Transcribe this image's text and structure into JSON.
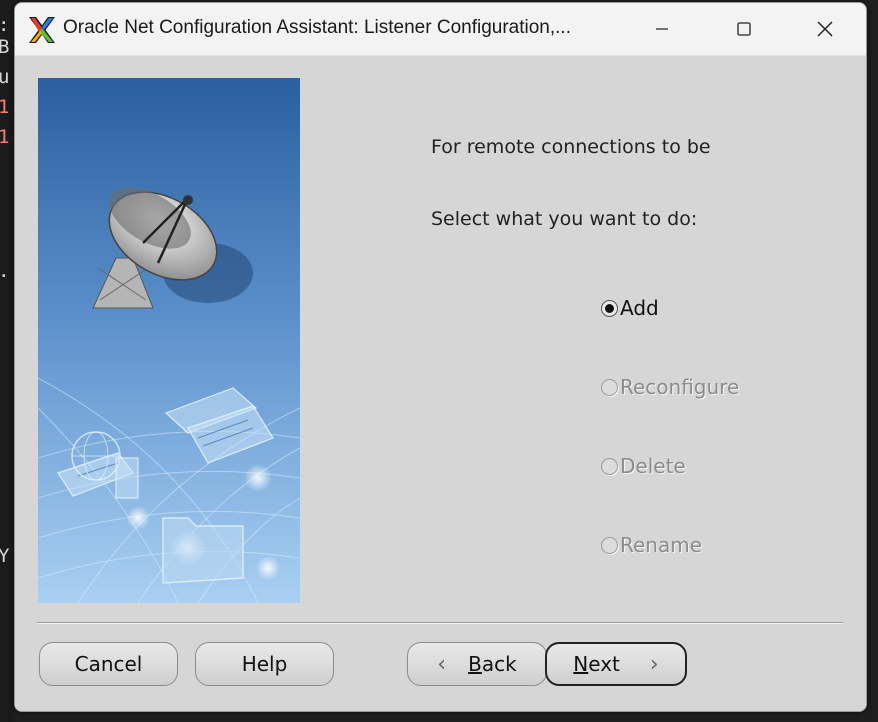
{
  "background": {
    "chars": [
      {
        "text": ":",
        "color": "#d6d6d6"
      },
      {
        "text": "B",
        "color": "#d6d6d6"
      },
      {
        "text": "u",
        "color": "#d6d6d6"
      },
      {
        "text": "1",
        "color": "#ff7b72"
      },
      {
        "text": "1",
        "color": "#ff7b72"
      },
      {
        "text": ".",
        "color": "#d6d6d6"
      },
      {
        "text": "Y",
        "color": "#d6d6d6"
      }
    ]
  },
  "window": {
    "title": "Oracle Net Configuration Assistant: Listener Configuration,...",
    "controls": {
      "minimize": "minimize-icon",
      "maximize": "maximize-icon",
      "close": "close-icon"
    },
    "app_icon": "x-logo-icon"
  },
  "side_image": {
    "description_icon": "satellite-dish-network-illustration"
  },
  "main": {
    "line1": "For remote connections to be",
    "line2": "Select what you want to do:",
    "options": [
      {
        "label": "Add",
        "selected": true,
        "enabled": true
      },
      {
        "label": "Reconfigure",
        "selected": false,
        "enabled": false
      },
      {
        "label": "Delete",
        "selected": false,
        "enabled": false
      },
      {
        "label": "Rename",
        "selected": false,
        "enabled": false
      }
    ]
  },
  "buttons": {
    "cancel": "Cancel",
    "help": "Help",
    "back_mnemonic": "B",
    "back_rest": "ack",
    "next_mnemonic": "N",
    "next_rest": "ext"
  },
  "colors": {
    "accent": "#2f66a8",
    "background": "#d6d6d6"
  }
}
